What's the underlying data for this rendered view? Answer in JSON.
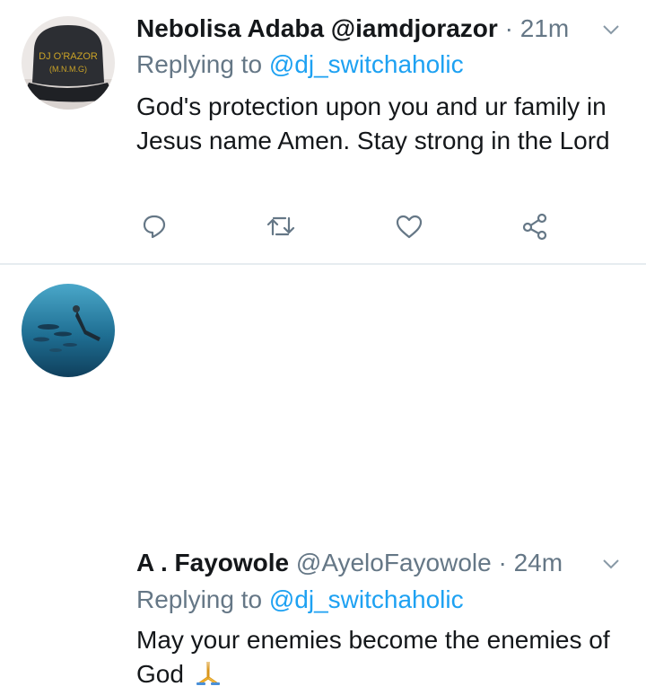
{
  "tweets": [
    {
      "display_name": "Nebolisa Adaba",
      "handle": "@iamdjorazor",
      "separator": "·",
      "time": "21m",
      "replying_prefix": "Replying to",
      "replying_to": "@dj_switchaholic",
      "text": "God's protection upon you and ur family in Jesus name Amen. Stay strong in the Lord",
      "avatar": {
        "cap_text_line1": "DJ O'RAZOR",
        "cap_text_line2": "(M.N.M.G)"
      }
    },
    {
      "display_name": "A . Fayowole",
      "handle": "@AyeloFayowole",
      "separator": "·",
      "time": "24m",
      "replying_prefix": "Replying to",
      "replying_to": "@dj_switchaholic",
      "text": "May your enemies become the enemies of God",
      "emoji": "folded-hands"
    }
  ],
  "icons": [
    "chevron-down-icon",
    "reply-icon",
    "retweet-icon",
    "like-icon",
    "share-icon"
  ],
  "colors": {
    "link": "#1da1f2",
    "muted": "#657786",
    "text": "#14171a",
    "divider": "#e6ecf0"
  }
}
